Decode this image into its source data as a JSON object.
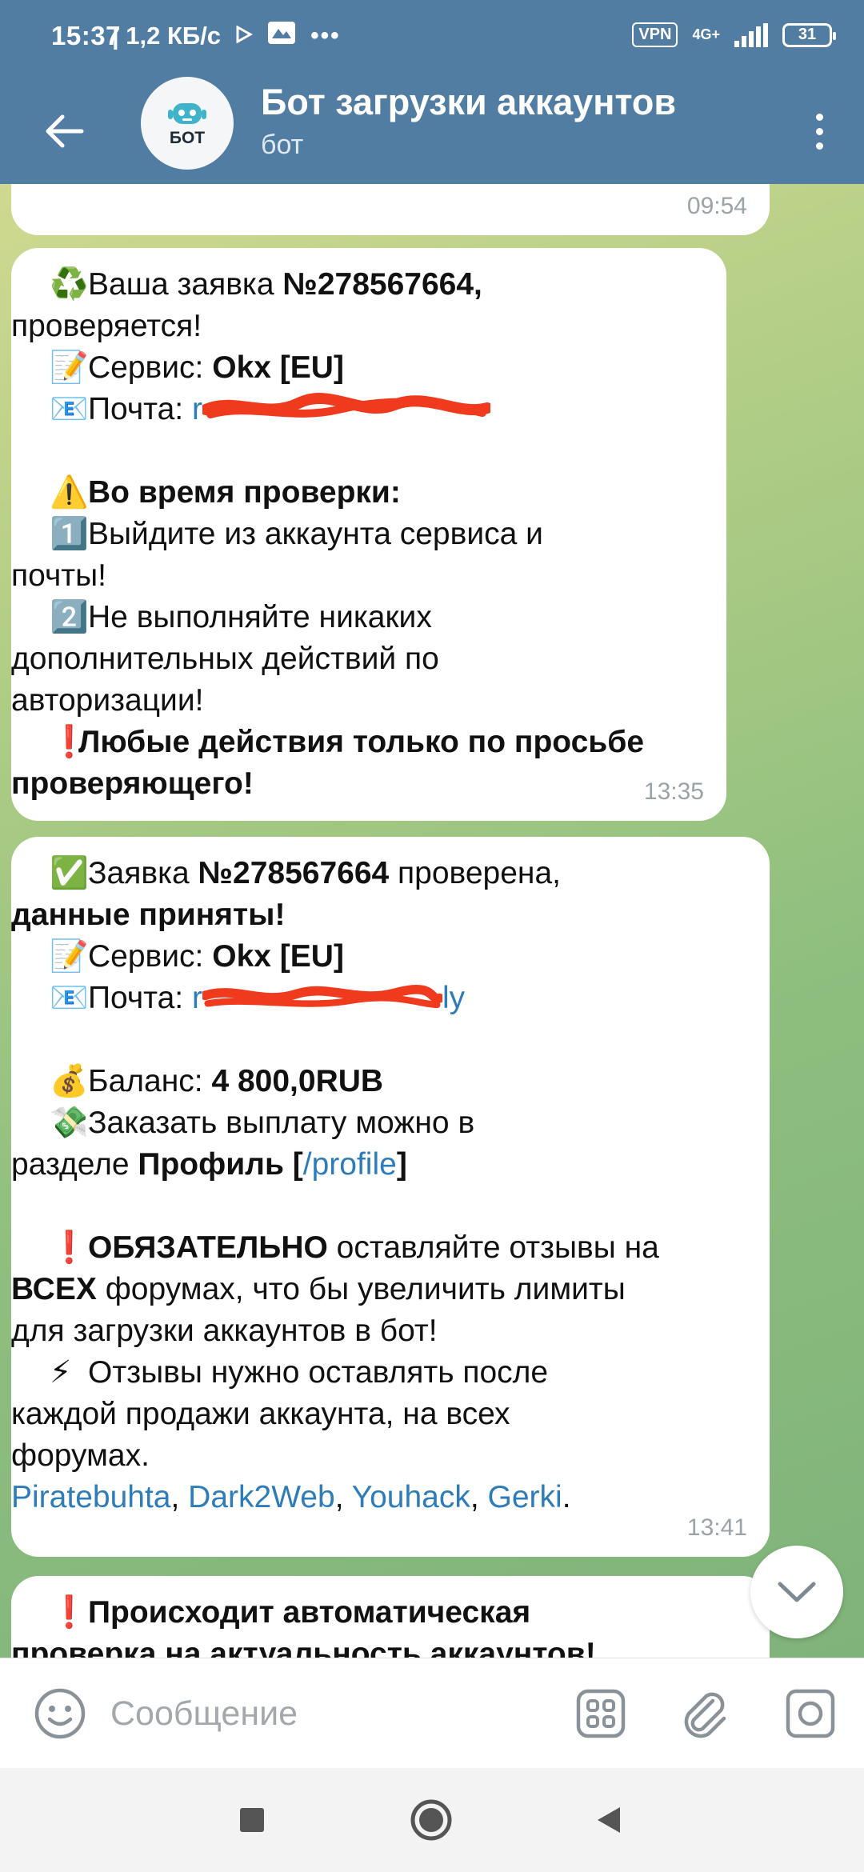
{
  "status_bar": {
    "time": "15:37",
    "speed": "| 1,2 КБ/с",
    "vpn": "VPN",
    "network": "4G+",
    "battery": "31"
  },
  "chat_header": {
    "avatar_text": "БОТ",
    "title": "Бот загрузки аккаунтов",
    "subtitle": "бот"
  },
  "messages": [
    {
      "time": "09:54"
    },
    {
      "time": "13:35",
      "line1_pre": "Ваша заявка ",
      "line1_bold": "№278567664,",
      "line2": "проверяется!",
      "service_label": "Сервис: ",
      "service_value": "Okx [EU]",
      "mail_label": "Почта: ",
      "mail_value_visible": "r",
      "warning_title": "Во время проверки:",
      "step1_a": "Выйдите из аккаунта сервиса и",
      "step1_b": "почты!",
      "step2_a": "Не выполняйте никаких",
      "step2_b": "дополнительных действий по",
      "step2_c": "авторизации!",
      "note_a": "Любые действия только по просьбе",
      "note_b": "проверяющего!"
    },
    {
      "time": "13:41",
      "line1_pre": "Заявка ",
      "line1_bold": "№278567664",
      "line1_post": " проверена,",
      "line2": "данные приняты!",
      "service_label": "Сервис: ",
      "service_value": "Okx [EU]",
      "mail_label": "Почта: ",
      "mail_value_visible": "r",
      "mail_value_tail": "ly",
      "balance_label": "Баланс: ",
      "balance_value": "4 800,0RUB",
      "payout_a": "Заказать выплату можно в",
      "payout_b_pre": "разделе ",
      "payout_b_bold": "Профиль",
      "payout_b_open": " [",
      "payout_link": "/profile",
      "payout_b_close": "]",
      "must_bold": "ОБЯЗАТЕЛЬНО",
      "must_rest": " оставляйте отзывы на",
      "all_bold": "ВСЕХ",
      "all_rest": " форумах, что бы увеличить лимиты",
      "limits_line": "для загрузки аккаунтов в бот!",
      "reviews_a": "Отзывы нужно оставлять после",
      "reviews_b": "каждой продажи аккаунта, на всех",
      "reviews_c": "форумах.",
      "forums": [
        "Piratebuhta",
        "Dark2Web",
        "Youhack",
        "Gerki"
      ],
      "sep": ", ",
      "end": "."
    },
    {
      "line1": "Происходит автоматическая",
      "line2": "проверка на актуальность аккаунтов!"
    }
  ],
  "input": {
    "placeholder": "Сообщение"
  },
  "icons": {
    "back": "arrow-left-icon",
    "menu": "more-vertical-icon",
    "emoji": "smile-icon",
    "attach": "paperclip-icon",
    "camera": "camera-icon",
    "apps": "grid-icon",
    "scroll": "chevron-down-icon"
  },
  "colors": {
    "header": "#527da3",
    "link": "#2e7cb8",
    "time": "#9aa3a8"
  }
}
